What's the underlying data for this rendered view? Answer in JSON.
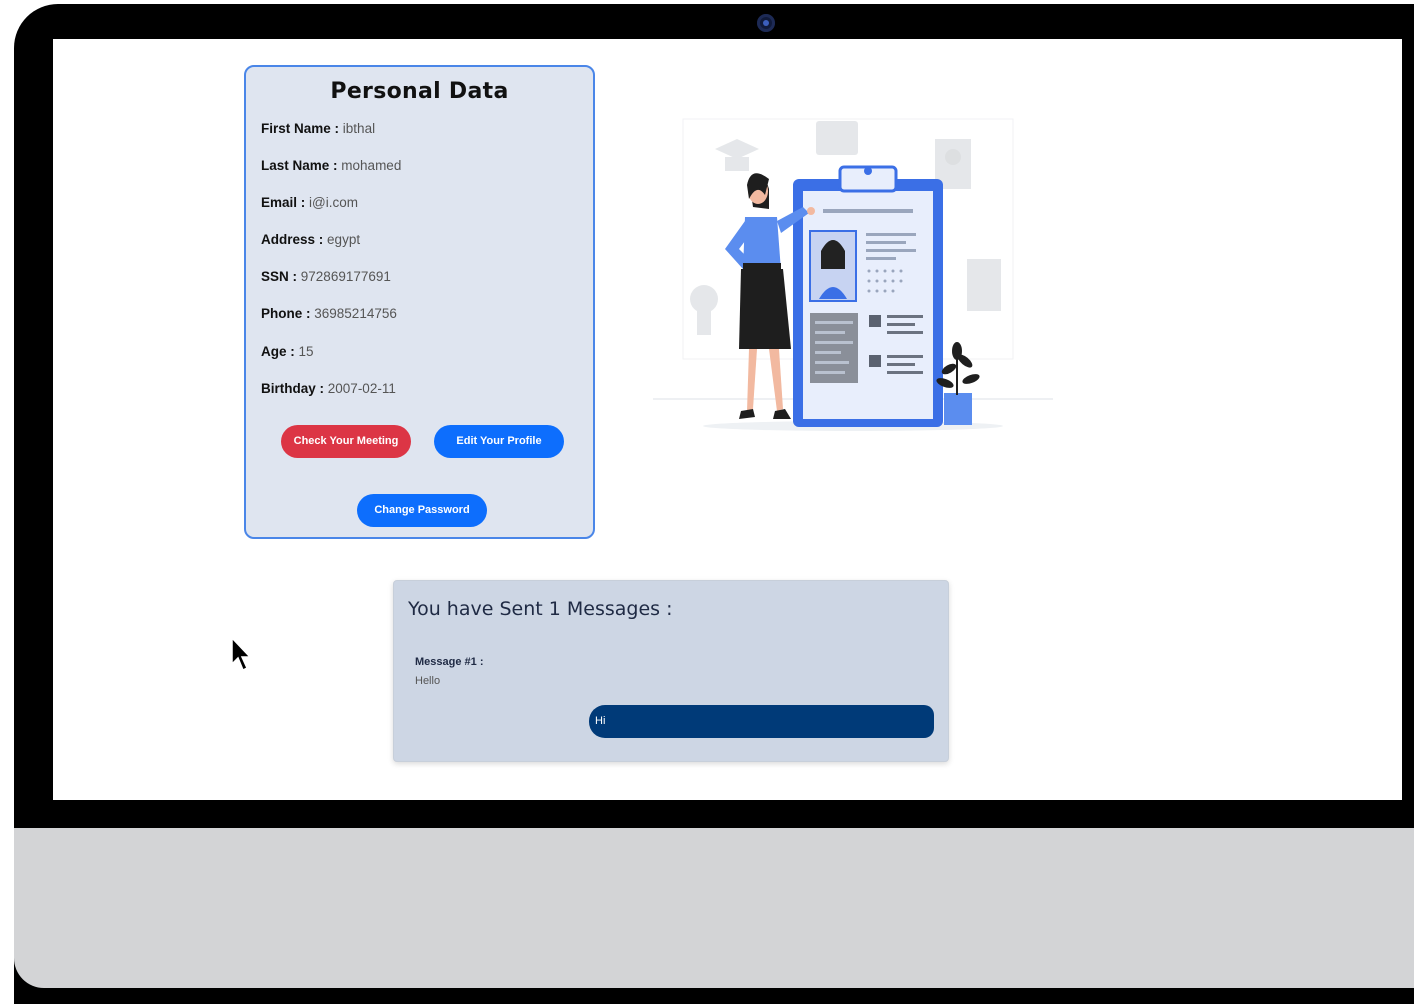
{
  "personal_data": {
    "title": "Personal Data",
    "fields": [
      {
        "label": "First Name :",
        "value": "ibthal"
      },
      {
        "label": "Last Name :",
        "value": "mohamed"
      },
      {
        "label": "Email :",
        "value": "i@i.com"
      },
      {
        "label": "Address :",
        "value": "egypt"
      },
      {
        "label": "SSN :",
        "value": "972869177691"
      },
      {
        "label": "Phone :",
        "value": "36985214756"
      },
      {
        "label": "Age :",
        "value": "15"
      },
      {
        "label": "Birthday :",
        "value": "2007-02-11"
      }
    ],
    "buttons": {
      "check_meeting": "Check Your Meeting",
      "edit_profile": "Edit Your Profile",
      "change_password": "Change Password"
    }
  },
  "messages": {
    "title": "You have Sent 1 Messages :",
    "items": [
      {
        "label": "Message #1 :",
        "text": "Hello",
        "reply": "Hi"
      }
    ]
  },
  "colors": {
    "card_border": "#4a86e8",
    "red_button": "#dc3545",
    "blue_button": "#0d6efd",
    "reply_bar": "#003a78"
  }
}
